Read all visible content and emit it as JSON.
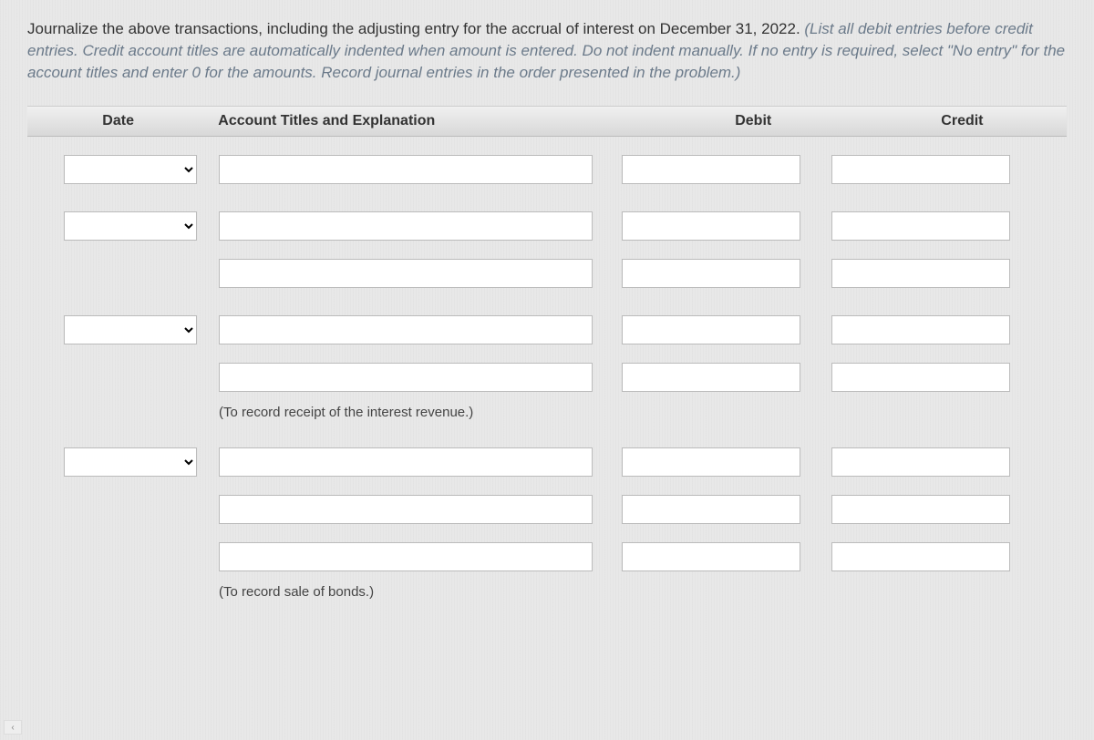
{
  "instruction": {
    "plain": "Journalize the above transactions, including the adjusting entry for the accrual of interest on December 31, 2022. ",
    "italic": "(List all debit entries before credit entries. Credit account titles are automatically indented when amount is entered. Do not indent manually. If no entry is required, select \"No entry\" for the account titles and enter 0 for the amounts. Record journal entries in the order presented in the problem.)"
  },
  "headers": {
    "date": "Date",
    "account": "Account Titles and Explanation",
    "debit": "Debit",
    "credit": "Credit"
  },
  "groups": [
    {
      "hasDate": true,
      "lines": 1,
      "caption": ""
    },
    {
      "hasDate": true,
      "lines": 2,
      "caption": ""
    },
    {
      "hasDate": true,
      "lines": 2,
      "caption": "(To record receipt of the interest revenue.)"
    },
    {
      "hasDate": true,
      "lines": 3,
      "caption": "(To record sale of bonds.)"
    }
  ],
  "icons": {
    "chevronLeft": "‹"
  }
}
